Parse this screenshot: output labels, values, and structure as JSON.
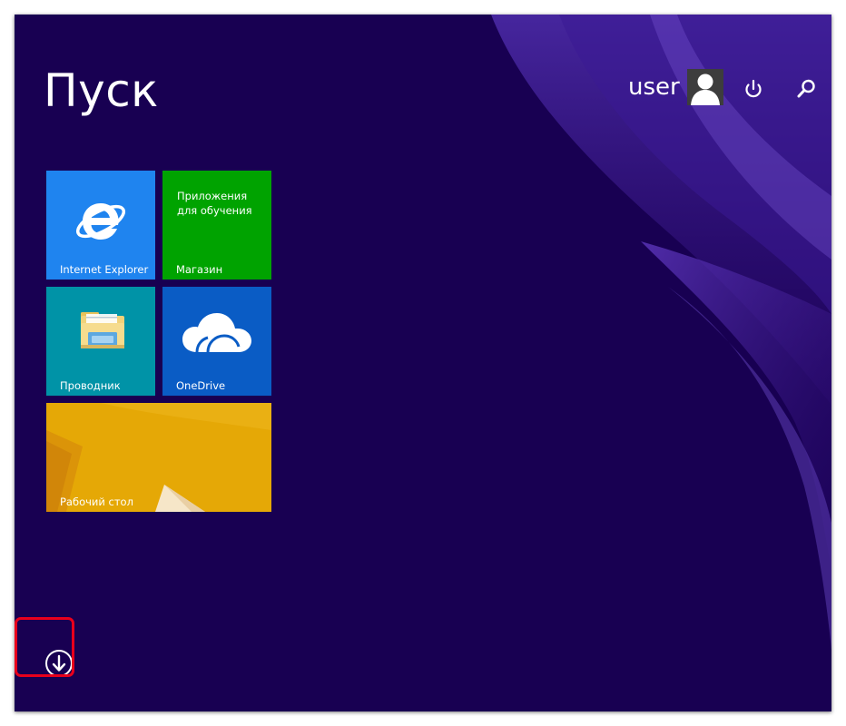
{
  "start": {
    "title": "Пуск"
  },
  "user": {
    "name": "user"
  },
  "tiles": {
    "internet_explorer": {
      "label": "Internet Explorer"
    },
    "store": {
      "description": "Приложения для обучения",
      "label": "Магазин"
    },
    "explorer": {
      "label": "Проводник"
    },
    "onedrive": {
      "label": "OneDrive"
    },
    "desktop": {
      "label": "Рабочий стол"
    }
  },
  "icons": {
    "avatar": "user-avatar-icon",
    "power": "power-icon",
    "search": "search-icon",
    "apps": "down-arrow-circle-icon"
  },
  "colors": {
    "background": "#180052",
    "ie_tile": "#1f84ef",
    "store_tile": "#00a300",
    "explorer_tile": "#0093a7",
    "onedrive_tile": "#0a5cc5",
    "desktop_tile": "#e5a806",
    "highlight": "#e8001c"
  }
}
